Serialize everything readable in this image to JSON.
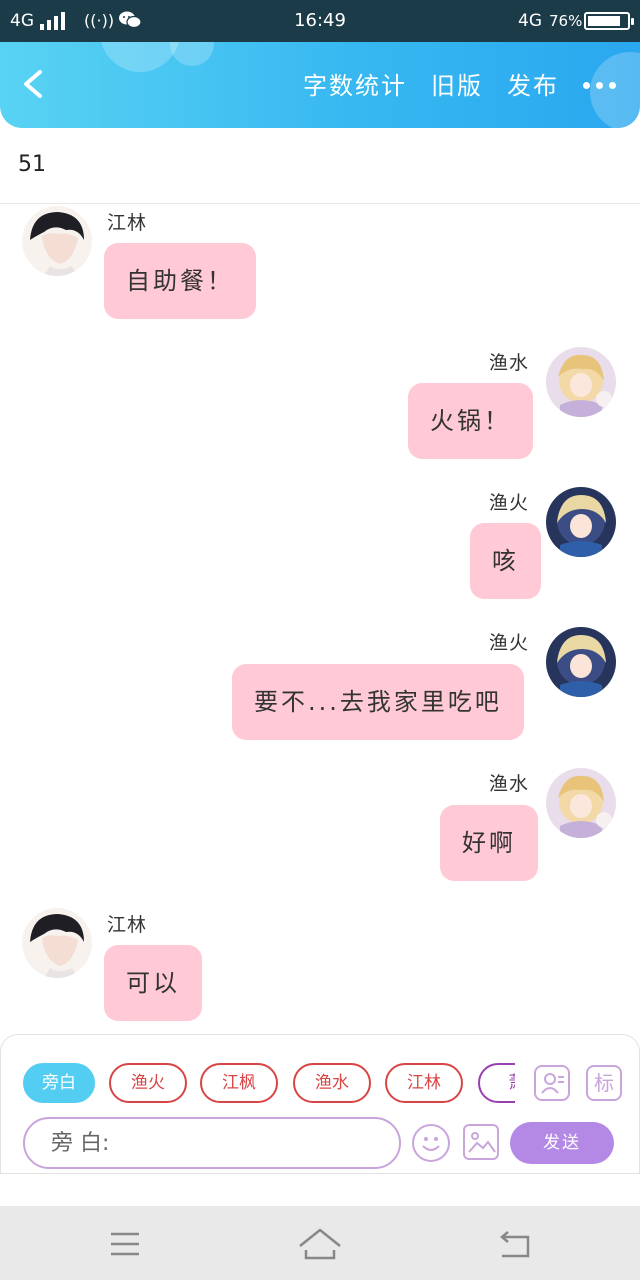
{
  "status_bar": {
    "network_left": "4G",
    "wifi_label": "((·))",
    "time": "16:49",
    "network_right": "4G",
    "battery": "76%"
  },
  "header": {
    "actions": [
      "字数统计",
      "旧版",
      "发布"
    ],
    "colors": {
      "gradient_start": "#59d3f3",
      "gradient_end": "#2aa7ef"
    }
  },
  "word_count": "51",
  "messages": [
    {
      "sender": "江林",
      "text": "自助餐！",
      "side": "left",
      "avatar": "boy"
    },
    {
      "sender": "渔水",
      "text": "火锅！",
      "side": "right",
      "avatar": "girl-pink"
    },
    {
      "sender": "渔火",
      "text": "咳",
      "side": "right",
      "avatar": "girl-blue"
    },
    {
      "sender": "渔火",
      "text": "要不...去我家里吃吧",
      "side": "right",
      "avatar": "girl-blue"
    },
    {
      "sender": "渔水",
      "text": "好啊",
      "side": "right",
      "avatar": "girl-pink"
    },
    {
      "sender": "江林",
      "text": "可以",
      "side": "left",
      "avatar": "boy"
    }
  ],
  "bubble_color": "#ffcad5",
  "characters": [
    "旁白",
    "渔火",
    "江枫",
    "渔水",
    "江林",
    "萧"
  ],
  "active_character": "旁白",
  "tools": {
    "role_icon": "person-card-icon",
    "tag_label": "标"
  },
  "input": {
    "placeholder": "旁 白:"
  },
  "send_label": "发送",
  "send_color": "#b489e6"
}
